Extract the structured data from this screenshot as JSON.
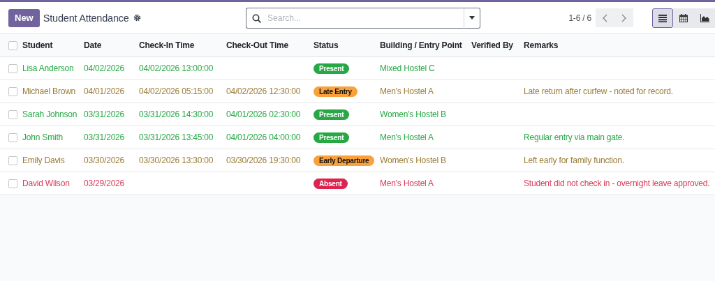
{
  "control_panel": {
    "new_button": "New",
    "title": "Student Attendance",
    "search": {
      "placeholder": "Search..."
    },
    "pager": "1-6 / 6",
    "views": [
      {
        "kind": "list",
        "selected": true
      },
      {
        "kind": "calendar",
        "selected": false
      },
      {
        "kind": "graph",
        "selected": false
      }
    ]
  },
  "table": {
    "select_all": {
      "checked": false
    },
    "columns": [
      "Student",
      "Date",
      "Check-In Time",
      "Check-Out Time",
      "Status",
      "Building / Entry Point",
      "Verified By",
      "Remarks"
    ],
    "rows": [
      {
        "kind": "success",
        "checked": false,
        "student": "Lisa Anderson",
        "date": "04/02/2026",
        "check_in": "04/02/2026 13:00:00",
        "check_out": "",
        "status": {
          "label": "Present",
          "kind": "success"
        },
        "building": "Mixed Hostel C",
        "remarks": ""
      },
      {
        "kind": "warning",
        "checked": false,
        "student": "Michael Brown",
        "date": "04/01/2026",
        "check_in": "04/02/2026 05:15:00",
        "check_out": "04/02/2026 12:30:00",
        "status": {
          "label": "Late Entry",
          "kind": "warning"
        },
        "building": "Men's Hostel A",
        "remarks": "Late return after curfew - noted for record."
      },
      {
        "kind": "success",
        "checked": false,
        "student": "Sarah Johnson",
        "date": "03/31/2026",
        "check_in": "03/31/2026 14:30:00",
        "check_out": "04/01/2026 02:30:00",
        "status": {
          "label": "Present",
          "kind": "success"
        },
        "building": "Women's Hostel B",
        "remarks": ""
      },
      {
        "kind": "success",
        "checked": false,
        "student": "John Smith",
        "date": "03/31/2026",
        "check_in": "03/31/2026 13:45:00",
        "check_out": "04/01/2026 04:00:00",
        "status": {
          "label": "Present",
          "kind": "success"
        },
        "building": "Men's Hostel A",
        "remarks": "Regular entry via main gate."
      },
      {
        "kind": "warning",
        "checked": false,
        "student": "Emily Davis",
        "date": "03/30/2026",
        "check_in": "03/30/2026 13:30:00",
        "check_out": "03/30/2026 19:30:00",
        "status": {
          "label": "Early Departure",
          "kind": "warning"
        },
        "building": "Women's Hostel B",
        "remarks": "Left early for family function."
      },
      {
        "kind": "danger",
        "checked": false,
        "student": "David Wilson",
        "date": "03/29/2026",
        "check_in": "",
        "check_out": "",
        "status": {
          "label": "Absent",
          "kind": "danger"
        },
        "building": "Men's Hostel A",
        "remarks": "Student did not check in - overnight leave approved."
      }
    ]
  }
}
